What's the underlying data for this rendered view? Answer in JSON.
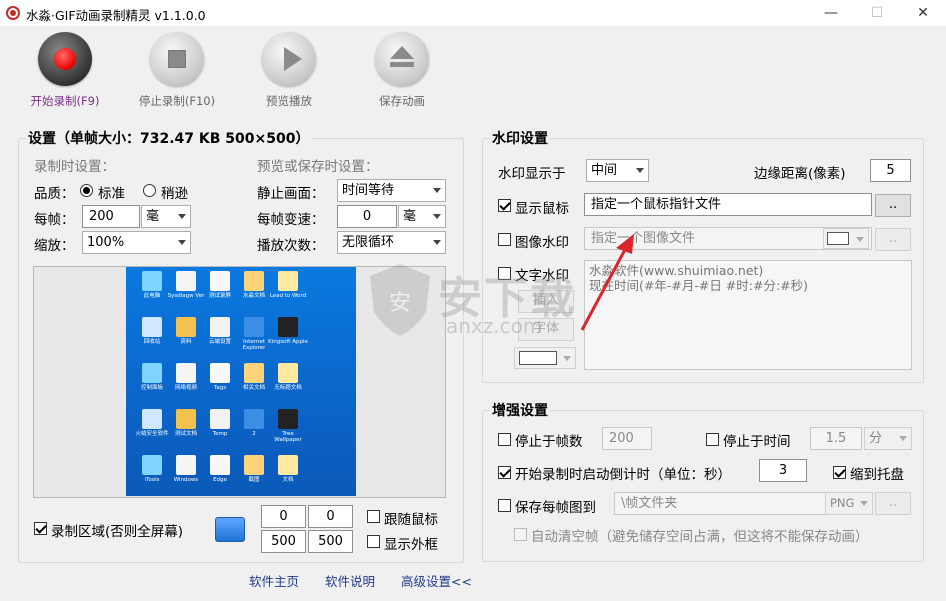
{
  "window": {
    "title": "水淼·GIF动画录制精灵 v1.1.0.0",
    "min": "—",
    "max": "☐",
    "close": "✕"
  },
  "toolbar": [
    {
      "label": "开始录制(F9)",
      "icon": "record-icon"
    },
    {
      "label": "停止录制(F10)",
      "icon": "stop-icon"
    },
    {
      "label": "预览播放",
      "icon": "play-icon"
    },
    {
      "label": "保存动画",
      "icon": "eject-save-icon"
    }
  ],
  "settings": {
    "title": "设置（单帧大小：732.47 KB 500×500）",
    "record_title": "录制时设置：",
    "preview_title": "预览或保存时设置：",
    "quality_label": "品质：",
    "quality_options": [
      "标准",
      "稍逊"
    ],
    "quality_selected": "标准",
    "per_frame_label": "每帧：",
    "per_frame_value": "200",
    "per_frame_unit": "毫",
    "scale_label": "缩放：",
    "scale_value": "100%",
    "still_label": "静止画面：",
    "still_value": "时间等待",
    "speed_label": "每帧变速：",
    "speed_value": "0",
    "speed_unit": "毫",
    "loop_label": "播放次数：",
    "loop_value": "无限循环",
    "region_label": "录制区域(否则全屏幕)",
    "region_checked": true,
    "region_x": "0",
    "region_y": "0",
    "region_w": "500",
    "region_h": "500",
    "follow_mouse_label": "跟随鼠标",
    "show_border_label": "显示外框"
  },
  "watermark": {
    "title": "水印设置",
    "position_label": "水印显示于",
    "position_value": "中间",
    "margin_label": "边缘距离(像素)",
    "margin_value": "5",
    "show_mouse_label": "显示鼠标",
    "show_mouse_checked": true,
    "mouse_file": "指定一个鼠标指针文件",
    "image_label": "图像水印",
    "image_placeholder": "指定一个图像文件",
    "text_label": "文字水印",
    "text_line1": "水淼软件(www.shuimiao.net)",
    "text_line2": "现在时间(#年-#月-#日 #时:#分:#秒)",
    "insert_label": "插入",
    "font_label": "字体",
    "browse": ".."
  },
  "enhance": {
    "title": "增强设置",
    "stop_frames_label": "停止于帧数",
    "stop_frames_value": "200",
    "stop_time_label": "停止于时间",
    "stop_time_value": "1.5",
    "stop_time_unit": "分",
    "countdown_label": "开始录制时启动倒计时（单位：秒）",
    "countdown_value": "3",
    "tray_label": "缩到托盘",
    "save_each_label": "保存每帧图到",
    "save_each_path": "\\帧文件夹",
    "save_each_format": "PNG",
    "auto_clear_label": "自动清空帧（避免储存空间占满，但这将不能保存动画）"
  },
  "footer": {
    "home": "软件主页",
    "help": "软件说明",
    "advanced": "高级设置<<"
  },
  "desktop_icons": [
    "此电脑",
    "Sysdiagw Ver",
    "测试录屏",
    "水淼文档",
    "Lead to Word",
    "回收站",
    "资料",
    "云端设置",
    "Internet Explorer",
    "Kingsoft Apple",
    "控制面板",
    "网络视频",
    "Tags",
    "相关文档",
    "无标题文档",
    "火绒安全软件",
    "测试文档",
    "Temp",
    "2",
    "Tree Wallpaper",
    "iTools",
    "Windows",
    "Edge",
    "截图",
    "文档"
  ],
  "watermark_overlay": {
    "brand_cn": "安下载",
    "brand_en": "anxz.com"
  },
  "colors": {
    "accent": "#7a2f8c",
    "record_red": "#e00000",
    "link": "#1f3a8a",
    "desktop_blue": "#0b6fd6"
  }
}
